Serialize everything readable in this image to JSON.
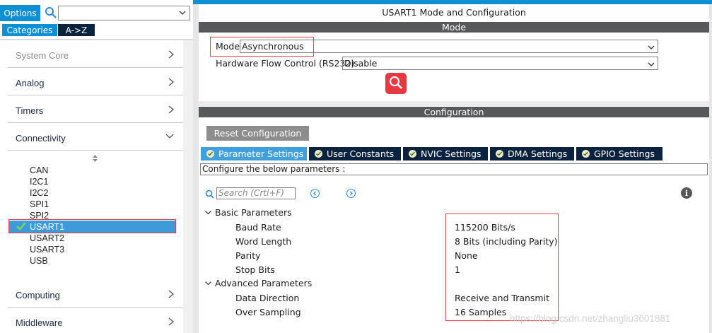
{
  "toolbar": {
    "options_label": "Options",
    "search_value": ""
  },
  "left_tabs": {
    "categories": "Categories",
    "az": "A->Z"
  },
  "categories": [
    {
      "label": "System Core"
    },
    {
      "label": "Analog"
    },
    {
      "label": "Timers"
    },
    {
      "label": "Connectivity"
    }
  ],
  "peripherals": [
    "CAN",
    "I2C1",
    "I2C2",
    "SPI1",
    "SPI2",
    "USART1",
    "USART2",
    "USART3",
    "USB"
  ],
  "bottom_categories": [
    {
      "label": "Computing"
    },
    {
      "label": "Middleware"
    }
  ],
  "mode_panel": {
    "title": "USART1 Mode and Configuration",
    "section": "Mode",
    "mode_label": "Mode",
    "mode_value": "Asynchronous",
    "hfc_label": "Hardware Flow Control (RS232)",
    "hfc_value": "Disable"
  },
  "config_panel": {
    "section": "Configuration",
    "reset_label": "Reset Configuration",
    "tabs": [
      "Parameter Settings",
      "User Constants",
      "NVIC Settings",
      "DMA Settings",
      "GPIO Settings"
    ],
    "instruction": "Configure the below parameters :",
    "search_placeholder": "Search (Crtl+F)"
  },
  "parameters": {
    "basic_title": "Basic Parameters",
    "advanced_title": "Advanced Parameters",
    "basic": [
      {
        "name": "Baud Rate",
        "value": "115200 Bits/s"
      },
      {
        "name": "Word Length",
        "value": "8 Bits (including Parity)"
      },
      {
        "name": "Parity",
        "value": "None"
      },
      {
        "name": "Stop Bits",
        "value": "1"
      }
    ],
    "advanced": [
      {
        "name": "Data Direction",
        "value": "Receive and Transmit"
      },
      {
        "name": "Over Sampling",
        "value": "16 Samples"
      }
    ]
  },
  "watermark": "https://blog.csdn.net/zhangliu3601881",
  "colors": {
    "accent_blue": "#0d8fd6",
    "selected_row": "#3d9bd9",
    "dark_navy": "#0c2340",
    "section_bar": "#56585a",
    "highlight_red": "#e24145"
  }
}
